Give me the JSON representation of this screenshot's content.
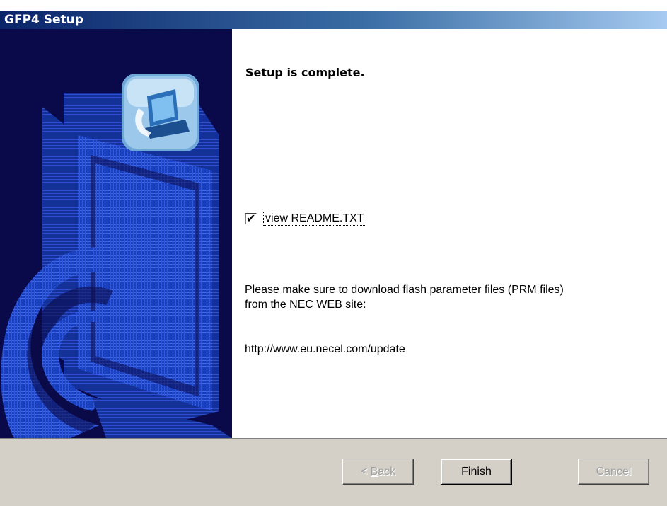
{
  "window": {
    "title": "GFP4 Setup"
  },
  "main": {
    "heading": "Setup is complete.",
    "checkbox": {
      "label": "view README.TXT",
      "checked": true,
      "mark": "✔"
    },
    "notice_line1": "Please make sure to download flash parameter files (PRM files)",
    "notice_line2": "from the NEC WEB site:",
    "url": "http://www.eu.necel.com/update"
  },
  "buttons": {
    "back_prefix": "< ",
    "back_accel": "B",
    "back_rest": "ack",
    "finish": "Finish",
    "cancel": "Cancel"
  },
  "colors": {
    "side_panel_bg": "#0a0a4a",
    "side_panel_art": "#2a56d6",
    "title_gradient_start": "#0a246a",
    "title_gradient_end": "#a6caf0",
    "dialog_bg": "#d4d0c8"
  },
  "icons": {
    "side_art": "setup-computer-art",
    "side_badge": "monitor-badge-icon"
  }
}
